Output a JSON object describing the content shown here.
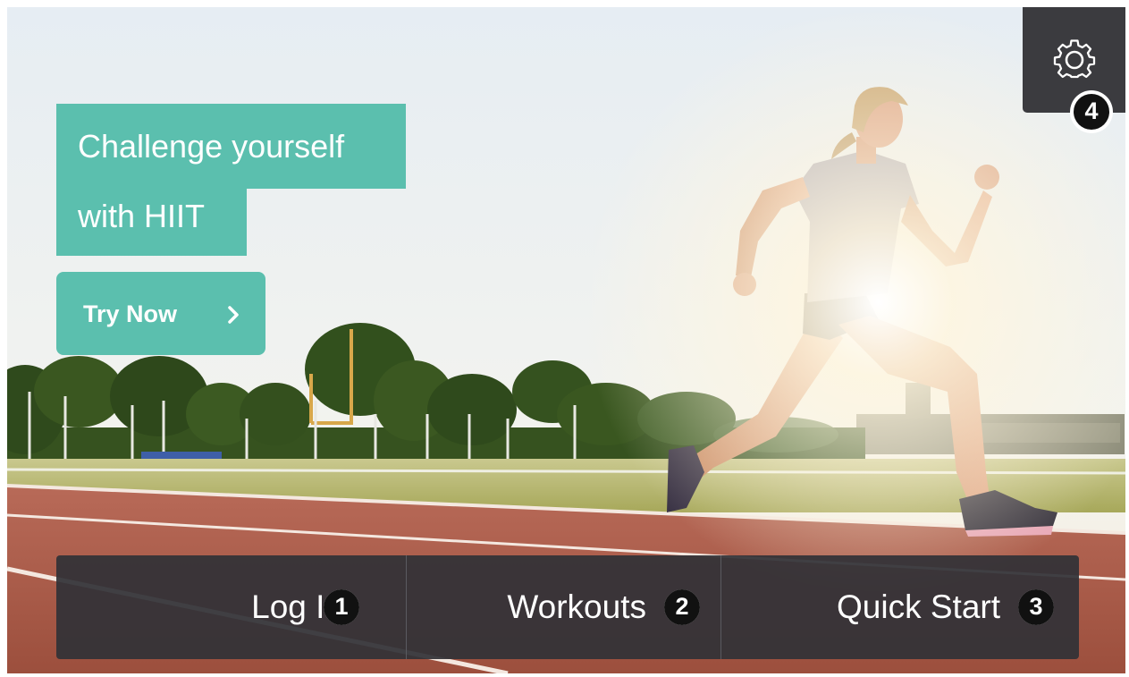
{
  "hero": {
    "headline_line1": "Challenge yourself",
    "headline_line2": "with HIIT",
    "cta_label": "Try Now",
    "background_description_icon": "runner-on-track-photo",
    "accent_color": "#5bbfae"
  },
  "settings": {
    "icon": "gear-icon",
    "badge": "4"
  },
  "nav": {
    "buttons": [
      {
        "label": "Log In",
        "badge": "1"
      },
      {
        "label": "Workouts",
        "badge": "2"
      },
      {
        "label": "Quick Start",
        "badge": "3"
      }
    ],
    "bar_color": "#323237"
  }
}
